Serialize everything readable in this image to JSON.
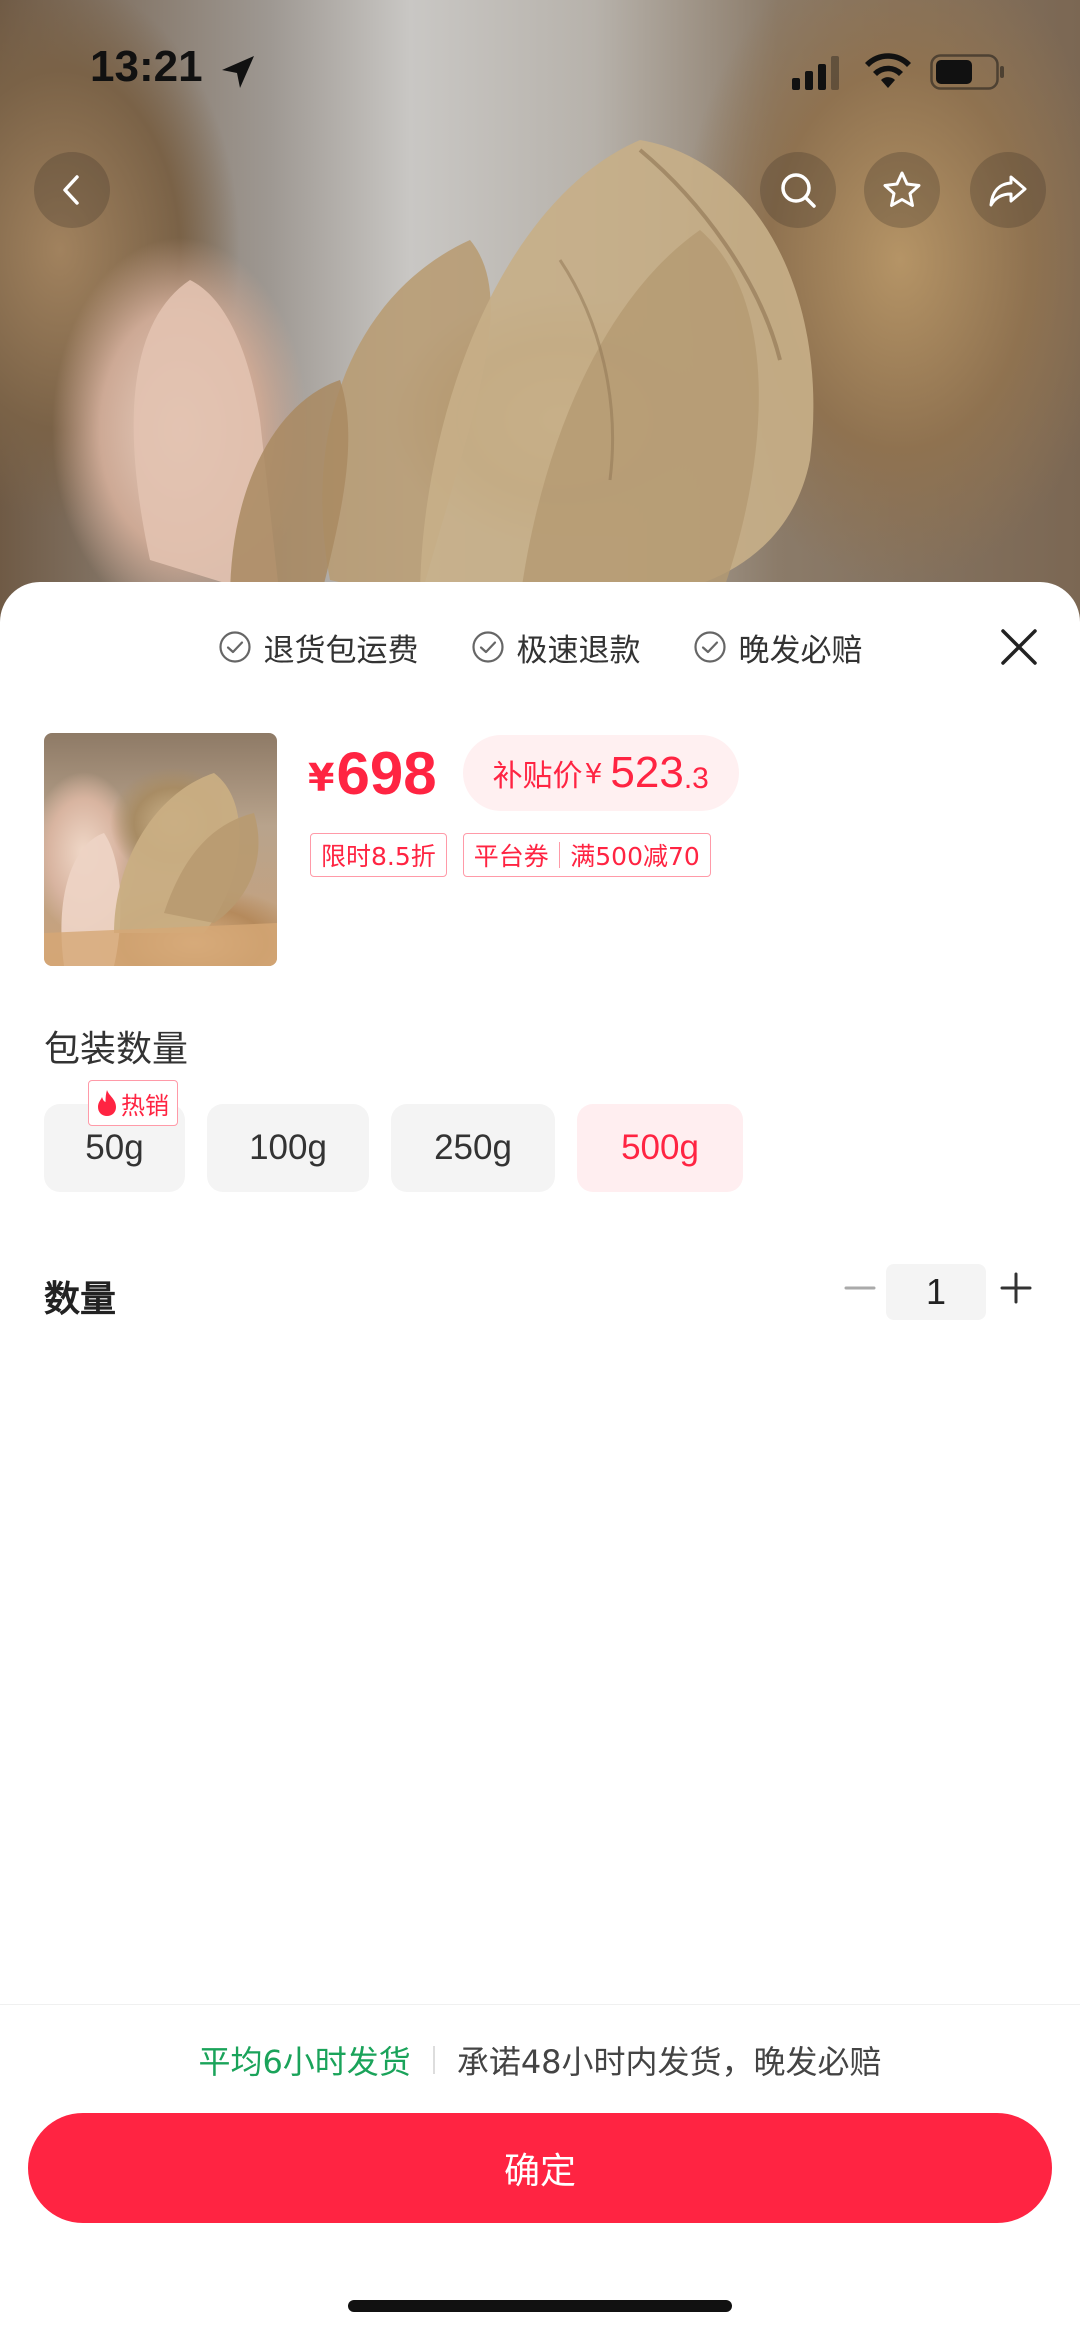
{
  "status_bar": {
    "time": "13:21"
  },
  "top_actions": {
    "back": "back-icon",
    "search": "search-icon",
    "favorite": "star-icon",
    "share": "share-icon"
  },
  "guarantees": [
    {
      "label": "退货包运费"
    },
    {
      "label": "极速退款"
    },
    {
      "label": "晚发必赔"
    }
  ],
  "price": {
    "symbol": "¥",
    "value": "698",
    "subsidy_label": "补贴价",
    "subsidy_symbol": "¥",
    "subsidy_int": "523",
    "subsidy_dec": ".3"
  },
  "tags": {
    "discount": "限时8.5折",
    "coupon_label": "平台券",
    "coupon_value": "满500减70"
  },
  "spec": {
    "title": "包装数量",
    "hot_badge": "热销",
    "options": [
      "50g",
      "100g",
      "250g",
      "500g"
    ],
    "selected": "500g"
  },
  "quantity": {
    "label": "数量",
    "value": "1"
  },
  "shipping": {
    "average": "平均6小时发货",
    "promise": "承诺48小时内发货，晚发必赔"
  },
  "confirm_label": "确定",
  "colors": {
    "accent": "#ff2442",
    "accent_light": "#fff0f1",
    "green": "#1aa35a"
  }
}
